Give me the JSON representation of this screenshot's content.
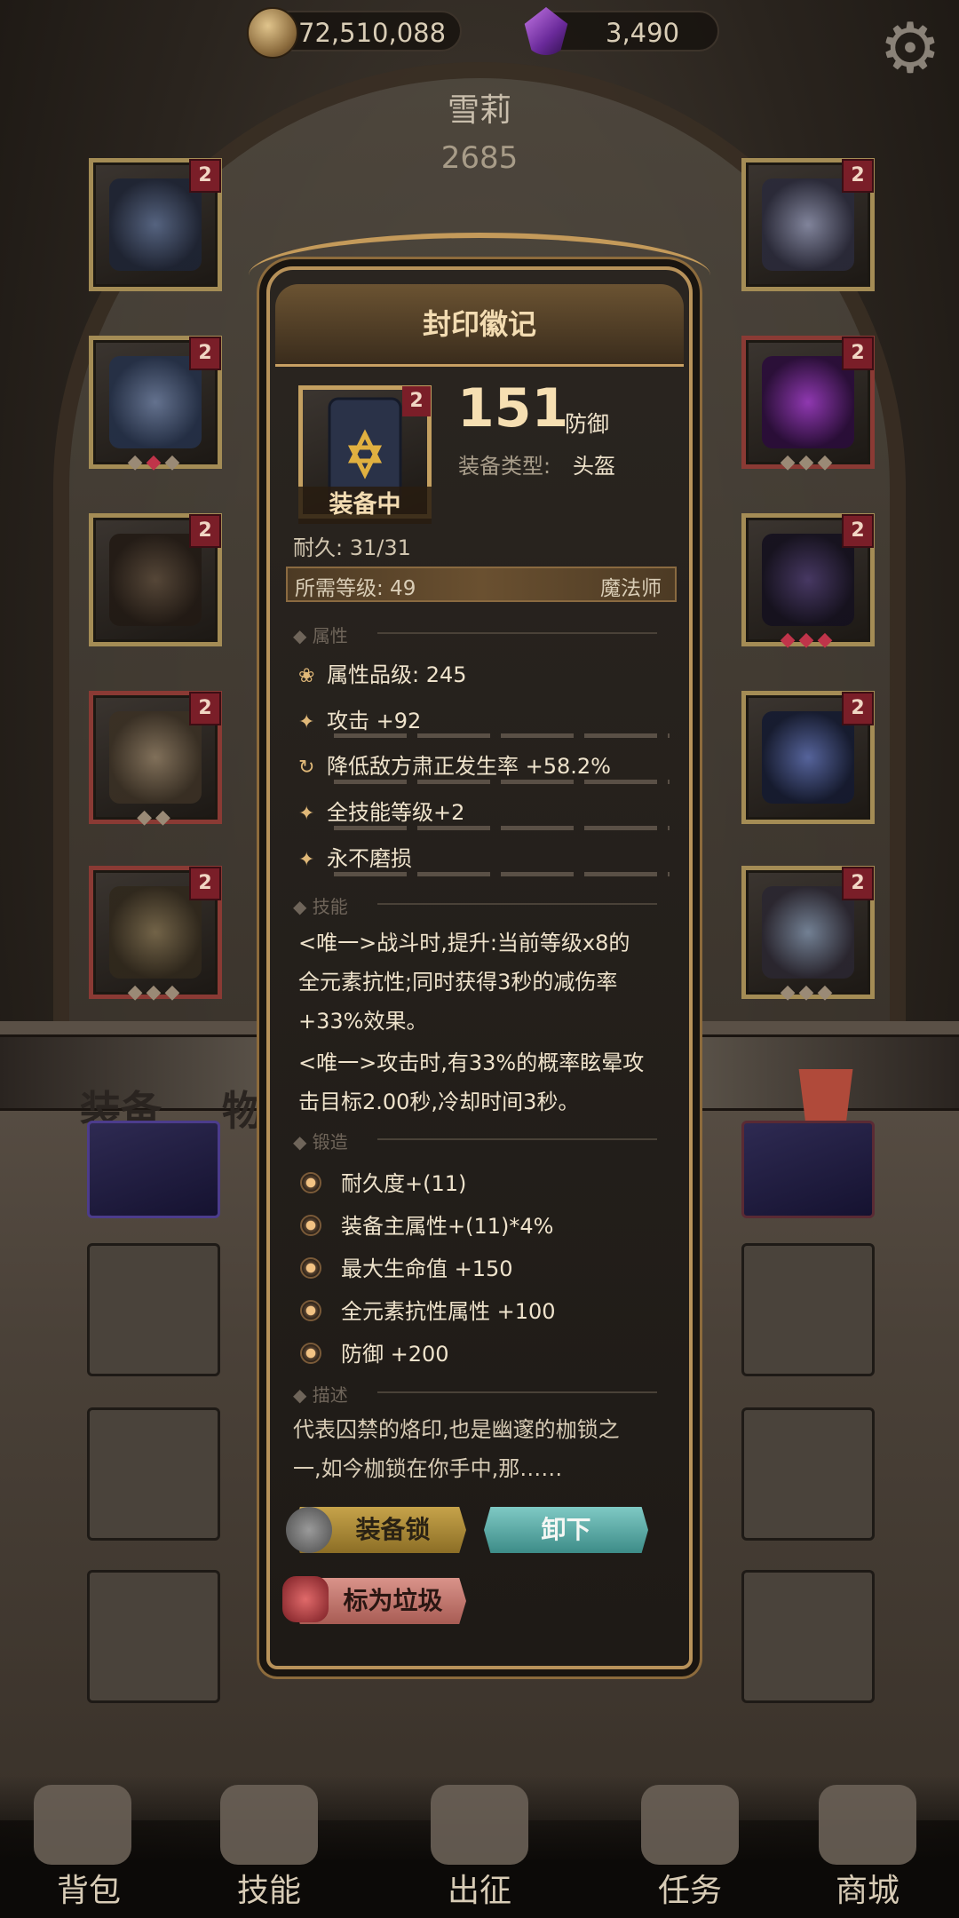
{
  "currency": {
    "coins": "72,510,088",
    "gems": "3,490"
  },
  "hero": {
    "name": "雪莉",
    "power": "2685"
  },
  "left_slots": [
    {
      "tier": "2"
    },
    {
      "tier": "2"
    },
    {
      "tier": "2"
    },
    {
      "tier": "2"
    },
    {
      "tier": "2"
    }
  ],
  "right_slots": [
    {
      "tier": "2"
    },
    {
      "tier": "2"
    },
    {
      "tier": "2"
    },
    {
      "tier": "2"
    },
    {
      "tier": "2"
    }
  ],
  "tabs": {
    "equip": "装备",
    "items": "物品"
  },
  "item": {
    "title": "封印徽记",
    "tier": "2",
    "equipped": "装备中",
    "defense_value": "151",
    "defense_label": "防御",
    "type_label": "装备类型:",
    "type_value": "头盔",
    "durability": "耐久: 31/31",
    "required_level": "所需等级: 49",
    "class": "魔法师"
  },
  "sections": {
    "attributes": "属性",
    "skills": "技能",
    "forge": "锻造",
    "description": "描述"
  },
  "attributes": [
    "属性品级: 245",
    "攻击 +92",
    "降低敌方肃正发生率 +58.2%",
    "全技能等级+2",
    "永不磨损"
  ],
  "skills": [
    "<唯一>战斗时,提升:当前等级x8的",
    "全元素抗性;同时获得3秒的减伤率",
    "+33%效果。",
    "<唯一>攻击时,有33%的概率眩晕攻",
    "击目标2.00秒,冷却时间3秒。"
  ],
  "forge": [
    "耐久度+(11)",
    "装备主属性+(11)*4%",
    "最大生命值 +150",
    "全元素抗性属性 +100",
    "防御 +200"
  ],
  "description": [
    "代表囚禁的烙印,也是幽邃的枷锁之",
    "一,如今枷锁在你手中,那……"
  ],
  "buttons": {
    "lock": "装备锁",
    "unequip": "卸下",
    "trash": "标为垃圾"
  },
  "nav": [
    "背包",
    "技能",
    "出征",
    "任务",
    "商城"
  ]
}
